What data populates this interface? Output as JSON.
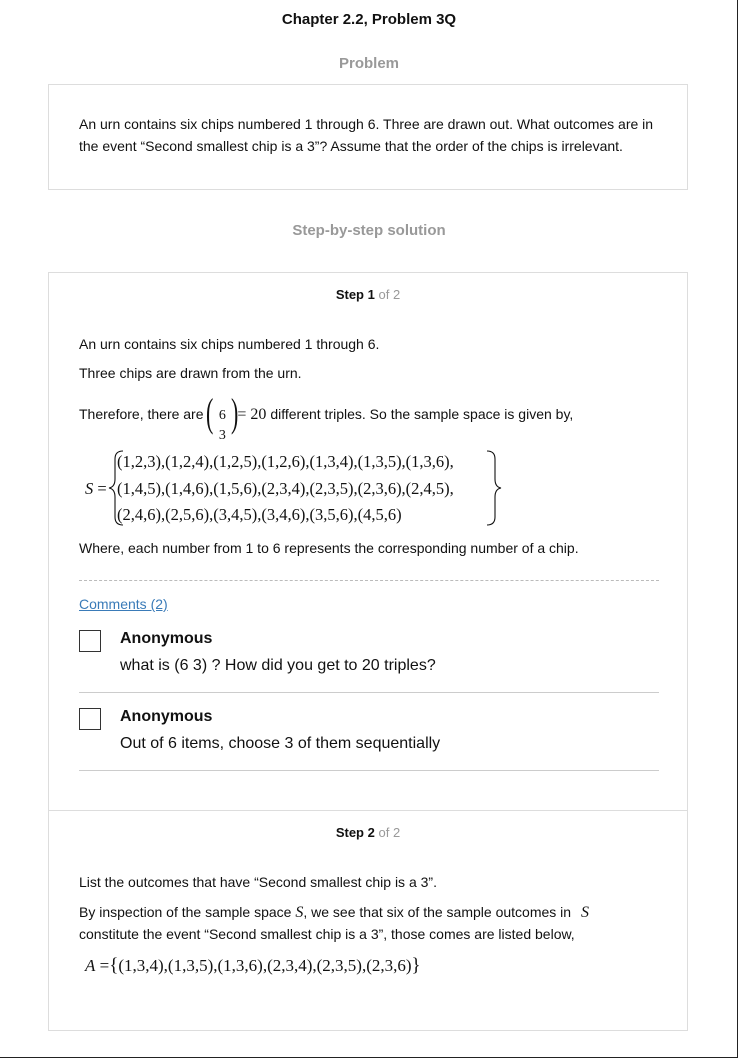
{
  "header": {
    "title": "Chapter 2.2, Problem 3Q",
    "problem_heading": "Problem",
    "solution_heading": "Step-by-step solution"
  },
  "problem": {
    "text": "An urn contains six chips numbered 1 through 6. Three are drawn out. What outcomes are in the event “Second smallest chip is a 3”? Assume that the order of the chips is irrelevant."
  },
  "step1": {
    "label_word": "Step",
    "label_num": "1",
    "label_of": "of 2",
    "line1": "An urn contains six chips numbered 1 through 6.",
    "line2": "Three chips are drawn from the urn.",
    "line3_pre": "Therefore, there are",
    "binom_top": "6",
    "binom_bot": "3",
    "binom_eq": "= 20",
    "line3_post": "different triples. So the sample space is given by,",
    "set_name": "S",
    "set_eq": "=",
    "set_row1": "(1,2,3),(1,2,4),(1,2,5),(1,2,6),(1,3,4),(1,3,5),(1,3,6),",
    "set_row2": "(1,4,5),(1,4,6),(1,5,6),(2,3,4),(2,3,5),(2,3,6),(2,4,5),",
    "set_row3": "(2,4,6),(2,5,6),(3,4,5),(3,4,6),(3,5,6),(4,5,6)",
    "line4": "Where, each number from 1 to 6 represents the corresponding number of a chip."
  },
  "comments": {
    "link_label": "Comments (2)",
    "items": [
      {
        "author": "Anonymous",
        "text": "what is (6 3) ? How did you get to 20 triples?"
      },
      {
        "author": "Anonymous",
        "text": "Out of 6 items, choose 3 of them sequentially"
      }
    ]
  },
  "step2": {
    "label_word": "Step",
    "label_num": "2",
    "label_of": "of 2",
    "line1": "List the outcomes that have “Second smallest chip is a 3”.",
    "line2_pre": "By inspection of the sample space",
    "line2_var": "S",
    "line2_mid": ", we see that six of the sample outcomes in",
    "line2_var2": "S",
    "line3": "constitute the event “Second smallest chip is a 3”, those comes are listed below,",
    "set_name": "A",
    "set_eq": "=",
    "set_items": "(1,3,4),(1,3,5),(1,3,6),(2,3,4),(2,3,5),(2,3,6)"
  }
}
